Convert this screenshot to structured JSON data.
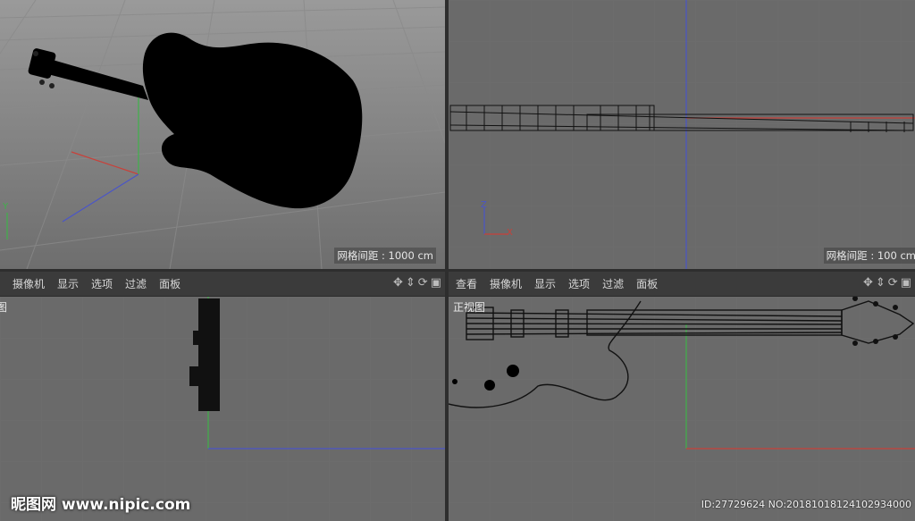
{
  "menu_items": [
    "查看",
    "摄像机",
    "显示",
    "选项",
    "过滤",
    "面板"
  ],
  "tool_icons": [
    "move-icon",
    "pan-icon",
    "rotate-icon",
    "maximize-icon"
  ],
  "viewports": {
    "perspective": {
      "grid_label": "网格间距 : 1000 cm",
      "axis_label": "Y"
    },
    "top": {
      "grid_label": "网格间距 : 100 cm",
      "axis_y": "Z",
      "axis_x": "X"
    },
    "right": {
      "name": "图"
    },
    "front": {
      "name": "正视图"
    }
  },
  "watermark": {
    "site": "昵图网 www.nipic.com",
    "id": "ID:27729624 NO:20181018124102934000"
  },
  "colors": {
    "x_axis": "#c8413a",
    "y_axis": "#3fb24a",
    "z_axis": "#4a55c8",
    "background": "#6a6a6a"
  }
}
